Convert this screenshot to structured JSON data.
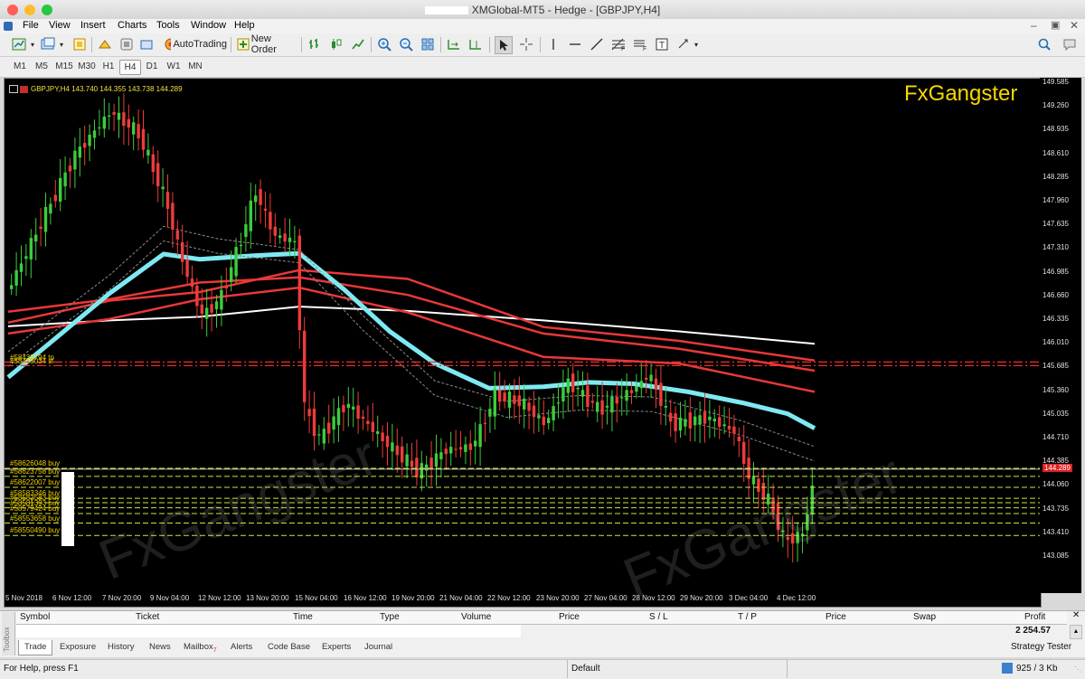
{
  "window": {
    "title": "XMGlobal-MT5 - Hedge - [GBPJPY,H4]"
  },
  "menu": [
    "File",
    "View",
    "Insert",
    "Charts",
    "Tools",
    "Window",
    "Help"
  ],
  "toolbar": {
    "autotrading_label": "AutoTrading",
    "new_order_label": "New Order"
  },
  "timeframes": {
    "items": [
      "M1",
      "M5",
      "M15",
      "M30",
      "H1",
      "H4",
      "D1",
      "W1",
      "MN"
    ],
    "active": "H4"
  },
  "chart": {
    "symbol_info": "GBPJPY,H4  143.740 144.355 143.738 144.289",
    "brand": "FxGangster",
    "watermark": "FxGangster",
    "current_price": "144.289",
    "price_labels": [
      "149.585",
      "149.260",
      "148.935",
      "148.610",
      "148.285",
      "147.960",
      "147.635",
      "147.310",
      "146.985",
      "146.660",
      "146.335",
      "146.010",
      "145.685",
      "145.360",
      "145.035",
      "144.710",
      "144.385",
      "144.060",
      "143.735",
      "143.410",
      "143.085"
    ],
    "date_labels": [
      "5 Nov 2018",
      "6 Nov 12:00",
      "7 Nov 20:00",
      "9 Nov 04:00",
      "12 Nov 12:00",
      "13 Nov 20:00",
      "15 Nov 04:00",
      "16 Nov 12:00",
      "19 Nov 20:00",
      "21 Nov 04:00",
      "22 Nov 12:00",
      "23 Nov 20:00",
      "27 Nov 04:00",
      "28 Nov 12:00",
      "29 Nov 20:00",
      "3 Dec 04:00",
      "4 Dec 12:00"
    ],
    "orders": [
      "#58626048 buy",
      "#58623758 buy",
      "#58622007 buy",
      "#58583346 buy",
      "#58582583 buy",
      "#58581393 buy",
      "#58579424 buy",
      "#58553658 buy",
      "#58550490 buy"
    ],
    "sell_orders": [
      "#58439034 sl",
      "#58438794 tp"
    ],
    "colors": {
      "bull": "#3dcc3d",
      "bear": "#ee3b3b",
      "background": "#000000",
      "ma_cyan": "#7fe9f2",
      "ma_red": "#e83838",
      "ma_white": "#ffffff",
      "order_line": "#c8e63c",
      "brand": "#f5d800"
    }
  },
  "toolbox": {
    "columns": [
      "Symbol",
      "Ticket",
      "Time",
      "Type",
      "Volume",
      "Price",
      "S / L",
      "T / P",
      "Price",
      "Swap",
      "Profit"
    ],
    "profit_total": "2 254.57",
    "tabs": [
      "Trade",
      "Exposure",
      "History",
      "News",
      "Mailbox",
      "Alerts",
      "Code Base",
      "Experts",
      "Journal"
    ],
    "active_tab": "Trade",
    "mailbox_badge": "7",
    "strategy_tester": "Strategy Tester",
    "side_label": "Toolbox"
  },
  "status": {
    "help": "For Help, press F1",
    "profile": "Default",
    "traffic": "925 / 3 Kb"
  }
}
